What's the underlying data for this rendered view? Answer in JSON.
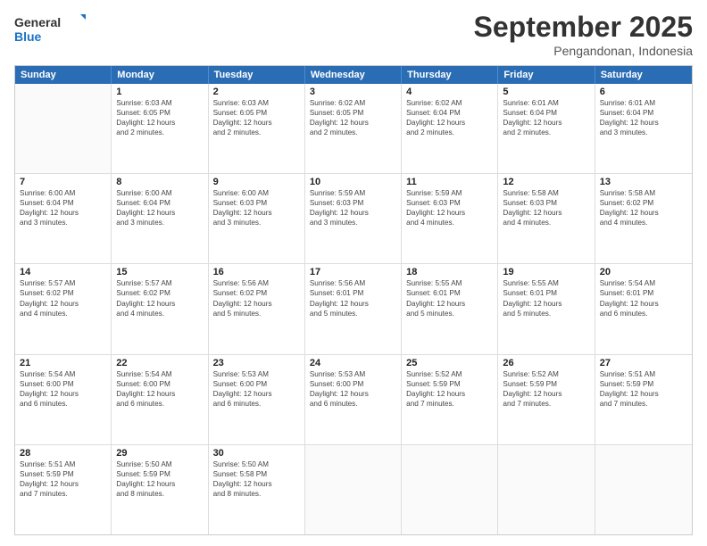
{
  "logo": {
    "line1": "General",
    "line2": "Blue"
  },
  "title": "September 2025",
  "location": "Pengandonan, Indonesia",
  "header_days": [
    "Sunday",
    "Monday",
    "Tuesday",
    "Wednesday",
    "Thursday",
    "Friday",
    "Saturday"
  ],
  "rows": [
    [
      {
        "day": "",
        "info": ""
      },
      {
        "day": "1",
        "info": "Sunrise: 6:03 AM\nSunset: 6:05 PM\nDaylight: 12 hours\nand 2 minutes."
      },
      {
        "day": "2",
        "info": "Sunrise: 6:03 AM\nSunset: 6:05 PM\nDaylight: 12 hours\nand 2 minutes."
      },
      {
        "day": "3",
        "info": "Sunrise: 6:02 AM\nSunset: 6:05 PM\nDaylight: 12 hours\nand 2 minutes."
      },
      {
        "day": "4",
        "info": "Sunrise: 6:02 AM\nSunset: 6:04 PM\nDaylight: 12 hours\nand 2 minutes."
      },
      {
        "day": "5",
        "info": "Sunrise: 6:01 AM\nSunset: 6:04 PM\nDaylight: 12 hours\nand 2 minutes."
      },
      {
        "day": "6",
        "info": "Sunrise: 6:01 AM\nSunset: 6:04 PM\nDaylight: 12 hours\nand 3 minutes."
      }
    ],
    [
      {
        "day": "7",
        "info": "Sunrise: 6:00 AM\nSunset: 6:04 PM\nDaylight: 12 hours\nand 3 minutes."
      },
      {
        "day": "8",
        "info": "Sunrise: 6:00 AM\nSunset: 6:04 PM\nDaylight: 12 hours\nand 3 minutes."
      },
      {
        "day": "9",
        "info": "Sunrise: 6:00 AM\nSunset: 6:03 PM\nDaylight: 12 hours\nand 3 minutes."
      },
      {
        "day": "10",
        "info": "Sunrise: 5:59 AM\nSunset: 6:03 PM\nDaylight: 12 hours\nand 3 minutes."
      },
      {
        "day": "11",
        "info": "Sunrise: 5:59 AM\nSunset: 6:03 PM\nDaylight: 12 hours\nand 4 minutes."
      },
      {
        "day": "12",
        "info": "Sunrise: 5:58 AM\nSunset: 6:03 PM\nDaylight: 12 hours\nand 4 minutes."
      },
      {
        "day": "13",
        "info": "Sunrise: 5:58 AM\nSunset: 6:02 PM\nDaylight: 12 hours\nand 4 minutes."
      }
    ],
    [
      {
        "day": "14",
        "info": "Sunrise: 5:57 AM\nSunset: 6:02 PM\nDaylight: 12 hours\nand 4 minutes."
      },
      {
        "day": "15",
        "info": "Sunrise: 5:57 AM\nSunset: 6:02 PM\nDaylight: 12 hours\nand 4 minutes."
      },
      {
        "day": "16",
        "info": "Sunrise: 5:56 AM\nSunset: 6:02 PM\nDaylight: 12 hours\nand 5 minutes."
      },
      {
        "day": "17",
        "info": "Sunrise: 5:56 AM\nSunset: 6:01 PM\nDaylight: 12 hours\nand 5 minutes."
      },
      {
        "day": "18",
        "info": "Sunrise: 5:55 AM\nSunset: 6:01 PM\nDaylight: 12 hours\nand 5 minutes."
      },
      {
        "day": "19",
        "info": "Sunrise: 5:55 AM\nSunset: 6:01 PM\nDaylight: 12 hours\nand 5 minutes."
      },
      {
        "day": "20",
        "info": "Sunrise: 5:54 AM\nSunset: 6:01 PM\nDaylight: 12 hours\nand 6 minutes."
      }
    ],
    [
      {
        "day": "21",
        "info": "Sunrise: 5:54 AM\nSunset: 6:00 PM\nDaylight: 12 hours\nand 6 minutes."
      },
      {
        "day": "22",
        "info": "Sunrise: 5:54 AM\nSunset: 6:00 PM\nDaylight: 12 hours\nand 6 minutes."
      },
      {
        "day": "23",
        "info": "Sunrise: 5:53 AM\nSunset: 6:00 PM\nDaylight: 12 hours\nand 6 minutes."
      },
      {
        "day": "24",
        "info": "Sunrise: 5:53 AM\nSunset: 6:00 PM\nDaylight: 12 hours\nand 6 minutes."
      },
      {
        "day": "25",
        "info": "Sunrise: 5:52 AM\nSunset: 5:59 PM\nDaylight: 12 hours\nand 7 minutes."
      },
      {
        "day": "26",
        "info": "Sunrise: 5:52 AM\nSunset: 5:59 PM\nDaylight: 12 hours\nand 7 minutes."
      },
      {
        "day": "27",
        "info": "Sunrise: 5:51 AM\nSunset: 5:59 PM\nDaylight: 12 hours\nand 7 minutes."
      }
    ],
    [
      {
        "day": "28",
        "info": "Sunrise: 5:51 AM\nSunset: 5:59 PM\nDaylight: 12 hours\nand 7 minutes."
      },
      {
        "day": "29",
        "info": "Sunrise: 5:50 AM\nSunset: 5:59 PM\nDaylight: 12 hours\nand 8 minutes."
      },
      {
        "day": "30",
        "info": "Sunrise: 5:50 AM\nSunset: 5:58 PM\nDaylight: 12 hours\nand 8 minutes."
      },
      {
        "day": "",
        "info": ""
      },
      {
        "day": "",
        "info": ""
      },
      {
        "day": "",
        "info": ""
      },
      {
        "day": "",
        "info": ""
      }
    ]
  ]
}
